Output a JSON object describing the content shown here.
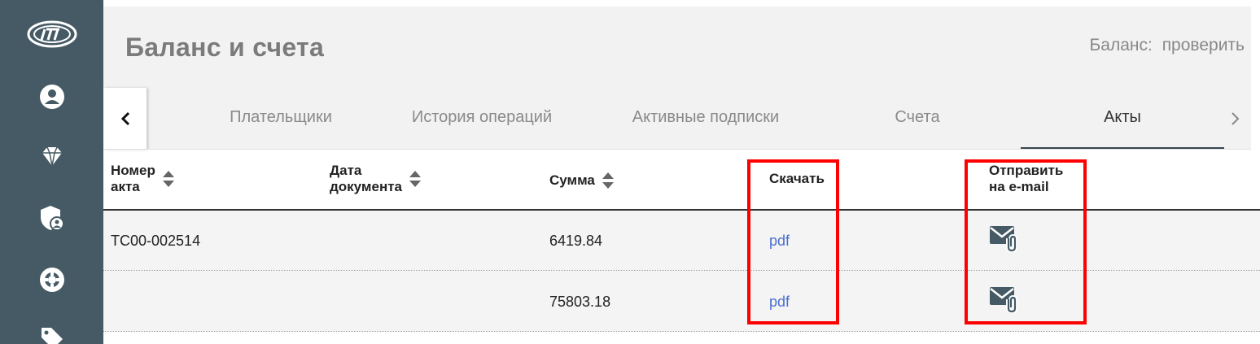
{
  "sidebar": {
    "icons": [
      "logo-icon",
      "user-icon",
      "diamond-icon",
      "shield-user-icon",
      "lifebuoy-icon",
      "tag-icon"
    ]
  },
  "header": {
    "title": "Баланс и счета",
    "balance_label": "Баланс:",
    "balance_link": "проверить"
  },
  "tabs": {
    "items": [
      "Плательщики",
      "История операций",
      "Активные подписки",
      "Счета",
      "Акты"
    ],
    "active_index": 4
  },
  "table": {
    "columns": {
      "number_line1": "Номер",
      "number_line2": "акта",
      "date_line1": "Дата",
      "date_line2": "документа",
      "amount": "Сумма",
      "download": "Скачать",
      "send_line1": "Отправить",
      "send_line2": "на e-mail"
    },
    "rows": [
      {
        "number": "ТС00-002514",
        "date": "",
        "amount": "6419.84",
        "download": "pdf"
      },
      {
        "number": "",
        "date": "",
        "amount": "75803.18",
        "download": "pdf"
      }
    ]
  },
  "colors": {
    "sidebar": "#455a64",
    "header_bg": "#f2f2f2",
    "link": "#4a6fd1",
    "highlight": "#ff0000"
  }
}
